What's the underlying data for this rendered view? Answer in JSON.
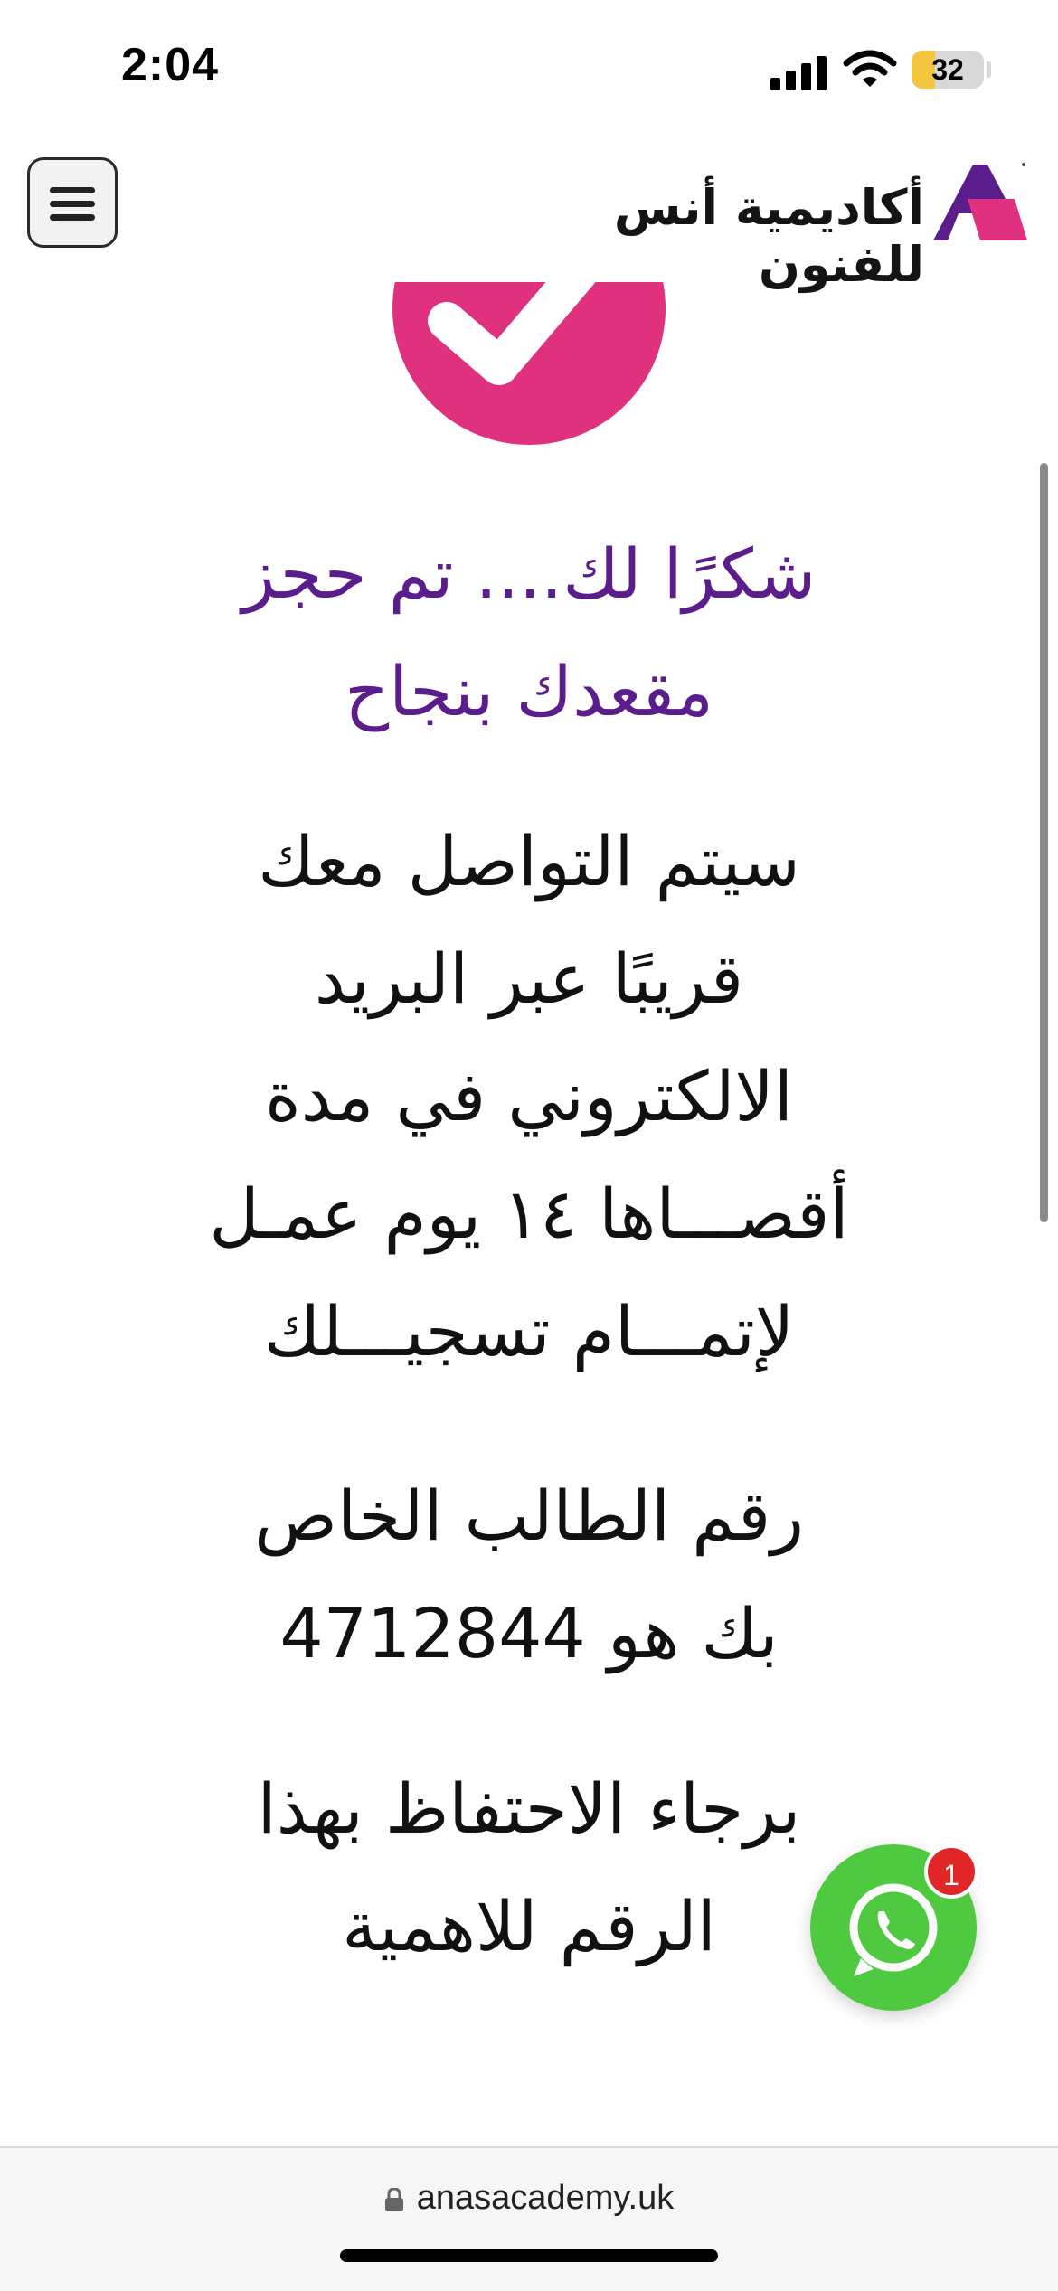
{
  "status_bar": {
    "time": "2:04",
    "battery": "32",
    "battery_level": 0.32
  },
  "header": {
    "brand_name": "أكاديمية أنس للفنون",
    "brand_colors": {
      "purple": "#5b1d8c",
      "pink": "#e0317f"
    },
    "menu_icon": "hamburger-menu-icon"
  },
  "success": {
    "icon": "checkmark-icon",
    "color": "#e0317f"
  },
  "content": {
    "title_line1": "شكرًا لك.... تم حجز",
    "title_line2": "مقعدك بنجاح",
    "contact_lines": [
      "سيتم التواصل معك",
      "قريبًا عبر البريد",
      "الالكتروني في مدة",
      "أقصـــاها ١٤ يوم عمـل",
      "لإتمـــام تسجيـــلك"
    ],
    "student_line1": "رقم الطالب الخاص",
    "student_line2_prefix": "بك هو",
    "student_number": "4712844",
    "keep_line1": "برجاء الاحتفاظ بهذا",
    "keep_line2": "الرقم للاهمية"
  },
  "whatsapp": {
    "badge_count": "1",
    "icon": "whatsapp-icon",
    "color": "#4fc940"
  },
  "browser": {
    "url": "anasacademy.uk"
  }
}
